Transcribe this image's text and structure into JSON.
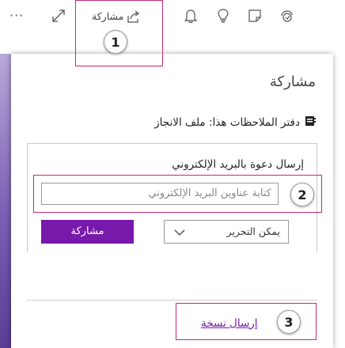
{
  "toolbar": {
    "share_label": "مشاركة",
    "icons": [
      "more-icon",
      "expand-icon",
      "share-icon",
      "bell-icon",
      "lightbulb-icon",
      "note-icon",
      "sticker-icon"
    ]
  },
  "panel": {
    "title": "مشاركة",
    "notebook_label": "دفتر الملاحظات هذا: ملف الانجاز",
    "invite_label": "إرسال دعوة بالبريد الإلكتروني",
    "email_placeholder": "كتابة عناوين البريد الإلكتروني",
    "permission_value": "يمكن التحرير",
    "share_button": "مشاركة",
    "send_copy": "إرسال نسخة"
  },
  "callouts": {
    "one": "1",
    "two": "2",
    "three": "3"
  },
  "colors": {
    "accent": "#7719aa",
    "callout": "#c52a74"
  }
}
